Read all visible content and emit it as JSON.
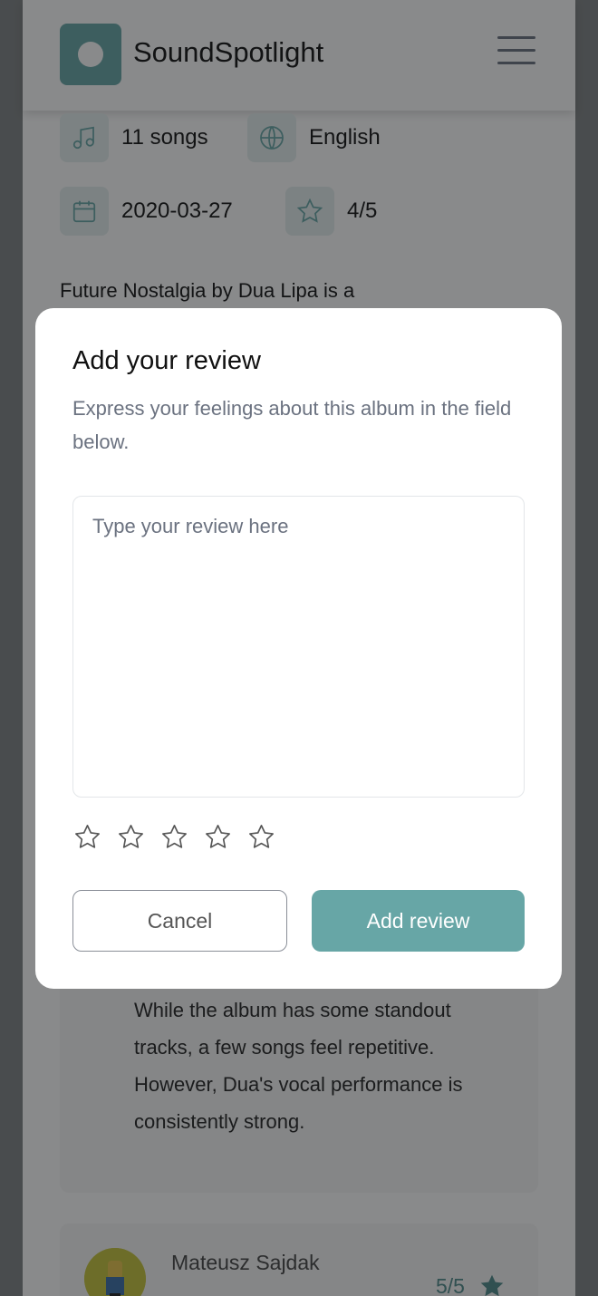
{
  "header": {
    "brand": "SoundSpotlight",
    "logo_icon": "record-icon",
    "menu_icon": "hamburger-icon"
  },
  "album_meta": {
    "songs": "11 songs",
    "language": "English",
    "release_date": "2020-03-27",
    "rating": "4/5"
  },
  "description": "Future Nostalgia by Dua Lipa is a",
  "reviews": [
    {
      "text": "While the album has some standout tracks, a few songs feel repetitive. However, Dua's vocal performance is consistently strong."
    },
    {
      "author": "Mateusz Sajdak",
      "score": "5/5"
    }
  ],
  "modal": {
    "title": "Add your review",
    "subtitle": "Express your feelings about this album in the field below.",
    "textarea_placeholder": "Type your review here",
    "rating_stars": 5,
    "selected_rating": 0,
    "cancel_label": "Cancel",
    "submit_label": "Add review"
  },
  "colors": {
    "accent": "#67a6a6",
    "overlay": "rgba(20,22,24,0.5)"
  }
}
